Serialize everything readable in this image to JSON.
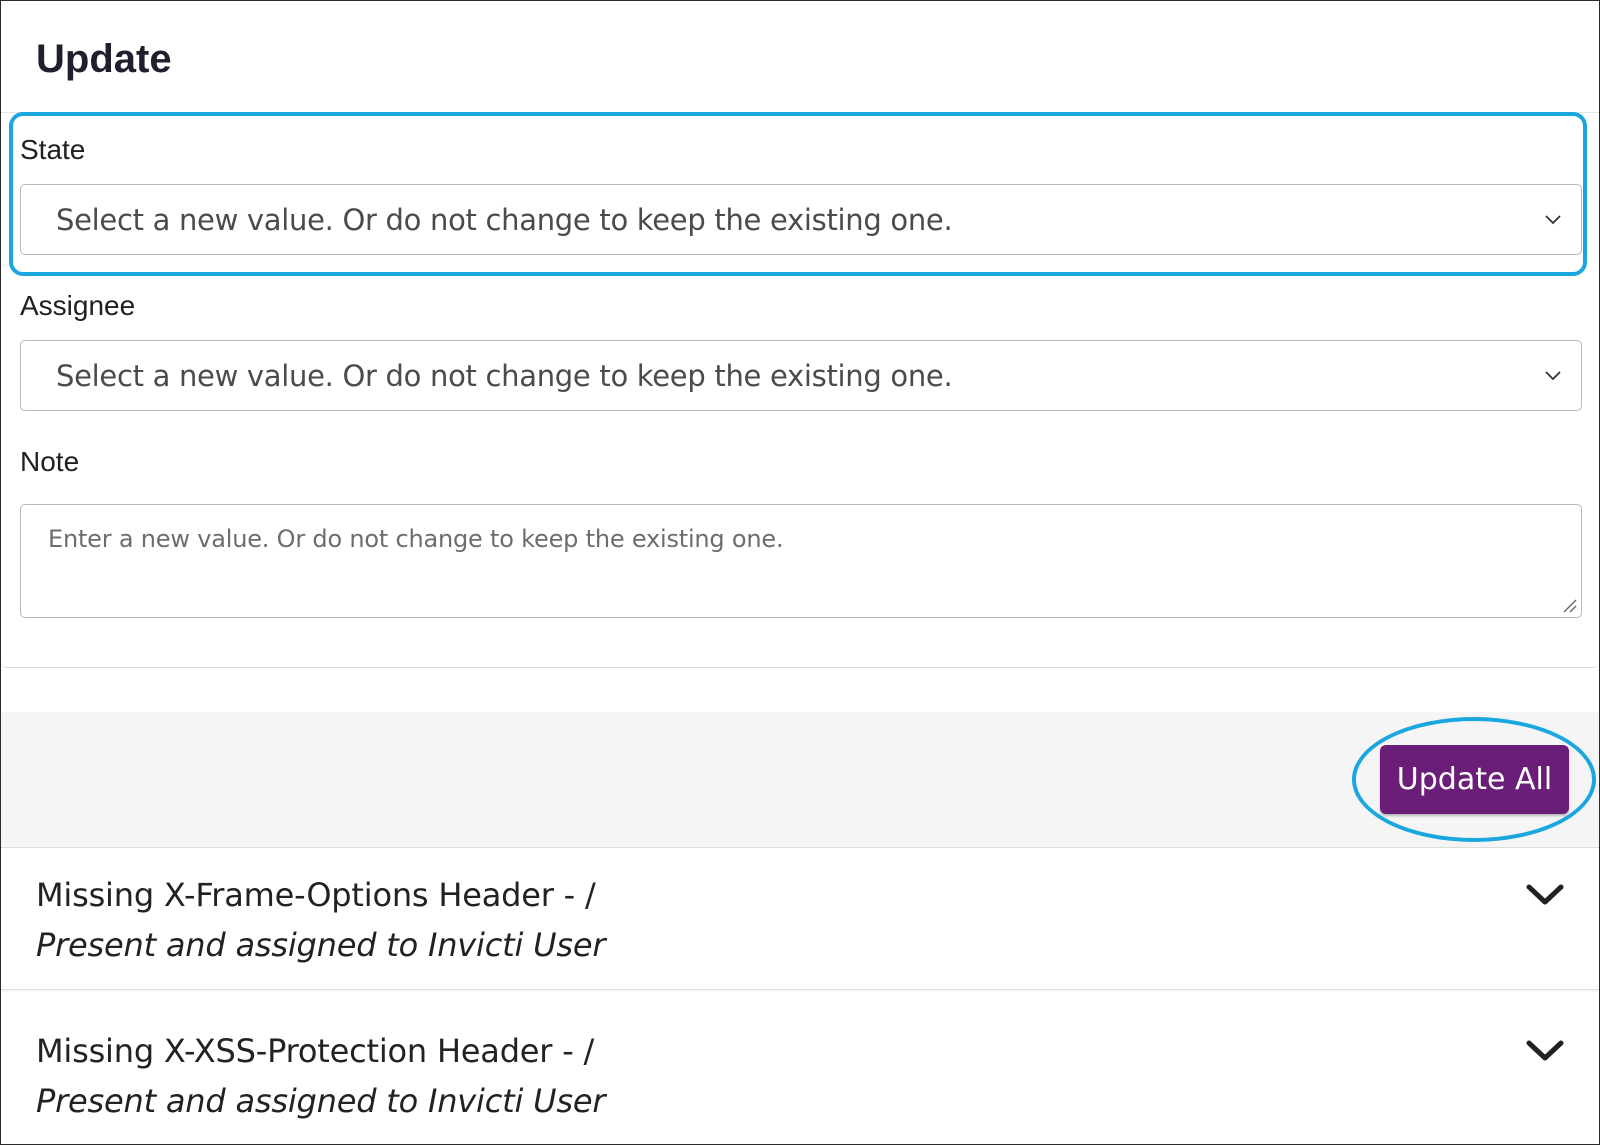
{
  "panel": {
    "title": "Update"
  },
  "fields": {
    "state": {
      "label": "State",
      "placeholder": "Select a new value. Or do not change to keep the existing one."
    },
    "assignee": {
      "label": "Assignee",
      "placeholder": "Select a new value. Or do not change to keep the existing one."
    },
    "note": {
      "label": "Note",
      "placeholder": "Enter a new value. Or do not change to keep the existing one."
    }
  },
  "actions": {
    "update_all_label": "Update All"
  },
  "issues": [
    {
      "title": "Missing X-Frame-Options Header - /",
      "status": "Present and assigned to Invicti User"
    },
    {
      "title": "Missing X-XSS-Protection Header - /",
      "status": "Present and assigned to Invicti User"
    }
  ],
  "colors": {
    "highlight": "#1aa7e0",
    "primary_button": "#6b1e78",
    "action_bar_bg": "#f5f5f5"
  },
  "icons": {
    "select_chevron": "chevron-down-icon",
    "card_chevron": "chevron-down-icon",
    "textarea_resize": "resize-grip-icon"
  }
}
